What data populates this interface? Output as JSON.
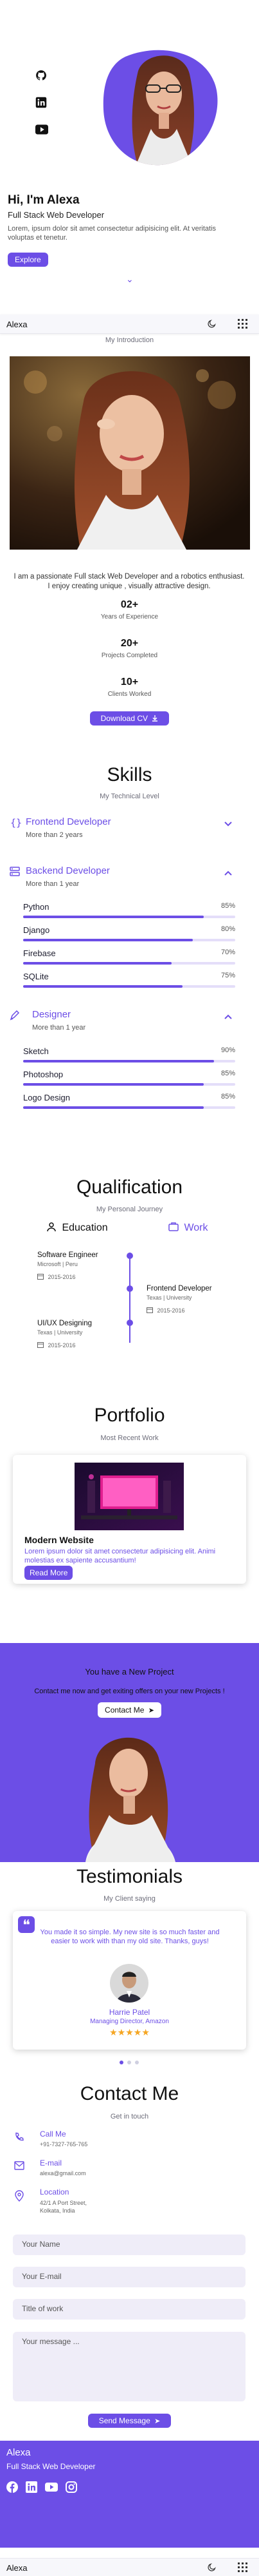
{
  "hero": {
    "greeting": "Hi, I'm Alexa",
    "role": "Full Stack Web Developer",
    "description": "Lorem, ipsum dolor sit amet consectetur adipisicing elit. At veritatis voluptas et tenetur.",
    "explore_label": "Explore",
    "scroll_indicator": "⌄"
  },
  "header": {
    "brand": "Alexa"
  },
  "about": {
    "subtitle": "My Introduction",
    "bio": "I am a passionate Full stack Web Developer and a robotics enthusiast. I enjoy creating unique , visually attractive design.",
    "stats": [
      {
        "value": "02+",
        "label": "Years of Experience"
      },
      {
        "value": "20+",
        "label": "Projects Completed"
      },
      {
        "value": "10+",
        "label": "Clients Worked"
      }
    ],
    "download_label": "Download CV"
  },
  "skills": {
    "title": "Skills",
    "subtitle": "My Technical Level",
    "groups": [
      {
        "name": "Frontend Developer",
        "experience": "More than 2 years"
      },
      {
        "name": "Backend Developer",
        "experience": "More than 1 year",
        "items": [
          {
            "name": "Python",
            "percent": 85,
            "label": "85%"
          },
          {
            "name": "Django",
            "percent": 80,
            "label": "80%"
          },
          {
            "name": "Firebase",
            "percent": 70,
            "label": "70%"
          },
          {
            "name": "SQLite",
            "percent": 75,
            "label": "75%"
          }
        ]
      },
      {
        "name": "Designer",
        "experience": "More than 1 year",
        "items": [
          {
            "name": "Sketch",
            "percent": 90,
            "label": "90%"
          },
          {
            "name": "Photoshop",
            "percent": 85,
            "label": "85%"
          },
          {
            "name": "Logo Design",
            "percent": 85,
            "label": "85%"
          }
        ]
      }
    ]
  },
  "qualification": {
    "title": "Qualification",
    "subtitle": "My Personal Journey",
    "tab_education": "Education",
    "tab_work": "Work",
    "entries": [
      {
        "title": "Software Engineer",
        "place": "Microsoft | Peru",
        "date": "2015-2016"
      },
      {
        "title": "Frontend Developer",
        "place": "Texas | University",
        "date": "2015-2016"
      },
      {
        "title": "UI/UX Designing",
        "place": "Texas | University",
        "date": "2015-2016"
      }
    ]
  },
  "portfolio": {
    "title": "Portfolio",
    "subtitle": "Most Recent Work",
    "project_title": "Modern Website",
    "project_desc": "Lorem ipsum dolor sit amet consectetur adipisicing elit. Animi molestias ex sapiente accusantium!",
    "read_more_label": "Read More"
  },
  "project_cta": {
    "heading": "You have a New Project",
    "text": "Contact me now and get exiting offers on your new Projects !",
    "contact_label": "Contact Me"
  },
  "testimonials": {
    "title": "Testimonials",
    "subtitle": "My Client saying",
    "quote_icon": "❝",
    "quote": "You made it so simple. My new site is so much faster and easier to work with than my old site. Thanks, guys!",
    "name": "Harrie Patel",
    "position": "Managing Director, Amazon",
    "rating": 5
  },
  "contact": {
    "title": "Contact Me",
    "subtitle": "Get in touch",
    "items": [
      {
        "label": "Call Me",
        "value": "+91-7327-765-765"
      },
      {
        "label": "E-mail",
        "value": "alexa@gmail.com"
      },
      {
        "label": "Location",
        "value": "42/1 A Port Street, Kolkata, India"
      }
    ],
    "placeholders": {
      "name": "Your Name",
      "email": "Your E-mail",
      "work": "Title of work",
      "message": "Your message ..."
    },
    "send_label": "Send Message"
  },
  "footer": {
    "brand": "Alexa",
    "role": "Full Stack Web Developer"
  },
  "bottom_bar": {
    "brand": "Alexa"
  },
  "colors": {
    "accent": "#6c4ee6",
    "accent_light": "#e4def9",
    "star": "#f5a623"
  }
}
